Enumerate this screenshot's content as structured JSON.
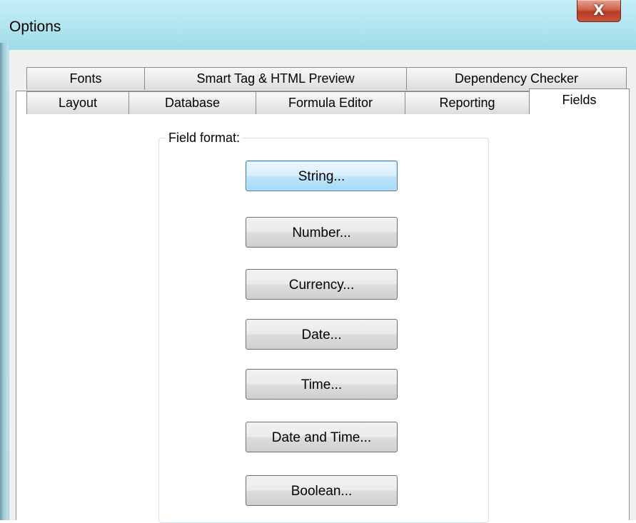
{
  "window": {
    "title": "Options",
    "close_glyph": "X"
  },
  "tabs": {
    "back_row": [
      {
        "label": "Fonts"
      },
      {
        "label": "Smart Tag & HTML Preview"
      },
      {
        "label": "Dependency Checker"
      }
    ],
    "front_row": [
      {
        "label": "Layout"
      },
      {
        "label": "Database"
      },
      {
        "label": "Formula Editor"
      },
      {
        "label": "Reporting"
      },
      {
        "label": "Fields",
        "active": true
      }
    ]
  },
  "field_format": {
    "legend": "Field format:",
    "buttons": [
      {
        "label": "String...",
        "default": true
      },
      {
        "label": "Number..."
      },
      {
        "label": "Currency..."
      },
      {
        "label": "Date..."
      },
      {
        "label": "Time..."
      },
      {
        "label": "Date and Time..."
      },
      {
        "label": "Boolean..."
      }
    ]
  },
  "colors": {
    "title_bar": "#b3e5f0",
    "close_button": "#c8553c",
    "default_button_border": "#3c7fb1",
    "tab_border": "#898c95"
  }
}
